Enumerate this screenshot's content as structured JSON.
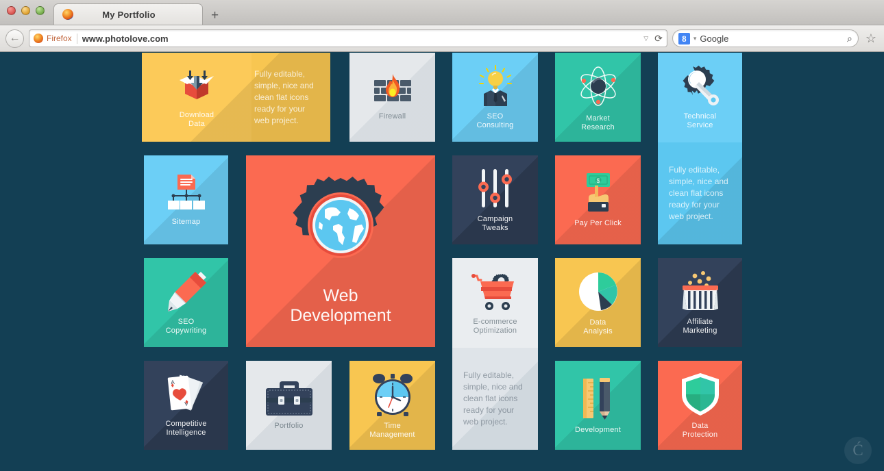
{
  "window": {
    "traffic_lights": [
      "close",
      "minimize",
      "zoom"
    ],
    "tab_title": "My Portfolio",
    "new_tab_label": "+"
  },
  "toolbar": {
    "back_label": "←",
    "firefox_label": "Firefox",
    "url_value": "www.photolove.com",
    "url_dropdown_icon": "▽",
    "reload_icon": "⟳",
    "search_engine": "Google",
    "search_engine_badge": "8",
    "search_icon": "⌕",
    "bookmark_star_icon": "☆"
  },
  "page": {
    "background_color": "#133f54",
    "watermark_glyph": "Ć",
    "description_text": "Fully editable, simple, nice and clean flat icons ready for your web project.",
    "tiles": [
      {
        "id": "download-data",
        "label": "Download\nData",
        "color": "#f8c651",
        "text_theme": "light",
        "kind": "wide-desc"
      },
      {
        "id": "firewall",
        "label": "Firewall",
        "color": "#e5e8eb",
        "text_theme": "dark",
        "kind": "square"
      },
      {
        "id": "seo-consulting",
        "label": "SEO\nConsulting",
        "color": "#6ccff6",
        "text_theme": "light",
        "kind": "square"
      },
      {
        "id": "market-research",
        "label": "Market\nResearch",
        "color": "#31c5a8",
        "text_theme": "light",
        "kind": "square"
      },
      {
        "id": "technical-service",
        "label": "Technical\nService",
        "color": "#6ccff6",
        "text_theme": "light",
        "kind": "tall-desc"
      },
      {
        "id": "sitemap",
        "label": "Sitemap",
        "color": "#6ccff6",
        "text_theme": "light",
        "kind": "square"
      },
      {
        "id": "web-development",
        "label": "Web\nDevelopment",
        "color": "#fb6a51",
        "text_theme": "light",
        "kind": "feature"
      },
      {
        "id": "campaign-tweaks",
        "label": "Campaign\nTweaks",
        "color": "#33425b",
        "text_theme": "light",
        "kind": "square"
      },
      {
        "id": "pay-per-click",
        "label": "Pay Per Click",
        "color": "#fb6a51",
        "text_theme": "light",
        "kind": "square"
      },
      {
        "id": "seo-copywriting",
        "label": "SEO\nCopywriting",
        "color": "#31c5a8",
        "text_theme": "light",
        "kind": "square"
      },
      {
        "id": "ecommerce-optimization",
        "label": "E-commerce\nOptimization",
        "color": "#e5e8eb",
        "text_theme": "dark",
        "kind": "tall-desc"
      },
      {
        "id": "data-analysis",
        "label": "Data\nAnalysis",
        "color": "#f8c651",
        "text_theme": "light",
        "kind": "square"
      },
      {
        "id": "affiliate-marketing",
        "label": "Affiliate\nMarketing",
        "color": "#33425b",
        "text_theme": "light",
        "kind": "square"
      },
      {
        "id": "competitive-intelligence",
        "label": "Competitive\nIntelligence",
        "color": "#33425b",
        "text_theme": "light",
        "kind": "square"
      },
      {
        "id": "portfolio",
        "label": "Portfolio",
        "color": "#e5e8eb",
        "text_theme": "dark",
        "kind": "square"
      },
      {
        "id": "time-management",
        "label": "Time\nManagement",
        "color": "#f8c651",
        "text_theme": "light",
        "kind": "square"
      },
      {
        "id": "development",
        "label": "Development",
        "color": "#31c5a8",
        "text_theme": "light",
        "kind": "square"
      },
      {
        "id": "data-protection",
        "label": "Data\nProtection",
        "color": "#fb6a51",
        "text_theme": "light",
        "kind": "square"
      }
    ]
  }
}
